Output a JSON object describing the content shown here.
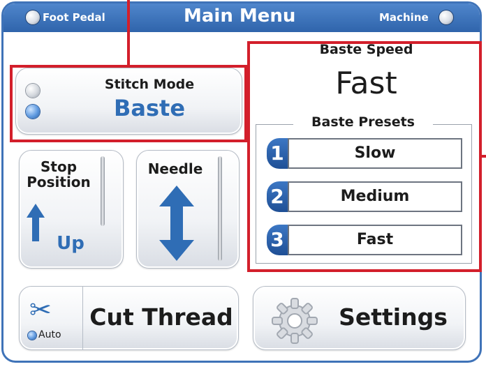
{
  "title": "Main Menu",
  "foot_pedal_label": "Foot Pedal",
  "machine_label": "Machine",
  "stitch_mode": {
    "label": "Stitch Mode",
    "value": "Baste"
  },
  "stop_position": {
    "label_line1": "Stop",
    "label_line2": "Position",
    "value": "Up"
  },
  "needle": {
    "label": "Needle"
  },
  "cut_thread": {
    "label": "Cut Thread",
    "auto_label": "Auto"
  },
  "settings": {
    "label": "Settings"
  },
  "baste_speed": {
    "label": "Baste Speed",
    "value": "Fast"
  },
  "baste_presets": {
    "title": "Baste Presets",
    "items": [
      {
        "number": "1",
        "label": "Slow"
      },
      {
        "number": "2",
        "label": "Medium"
      },
      {
        "number": "3",
        "label": "Fast"
      }
    ]
  },
  "colors": {
    "accent_blue": "#3f73b8",
    "value_blue": "#2f6db5",
    "highlight_red": "#d31f2b"
  }
}
